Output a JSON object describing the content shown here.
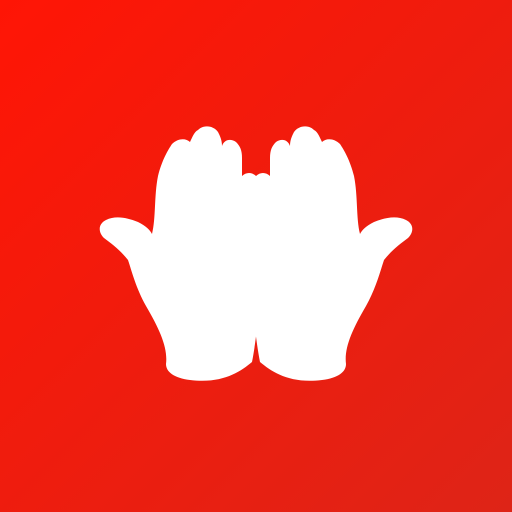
{
  "app_icon": {
    "icon": "open-hands-icon",
    "colors": {
      "background_start": "#ff1505",
      "background_end": "#de2417",
      "glyph": "#ffffff"
    }
  }
}
